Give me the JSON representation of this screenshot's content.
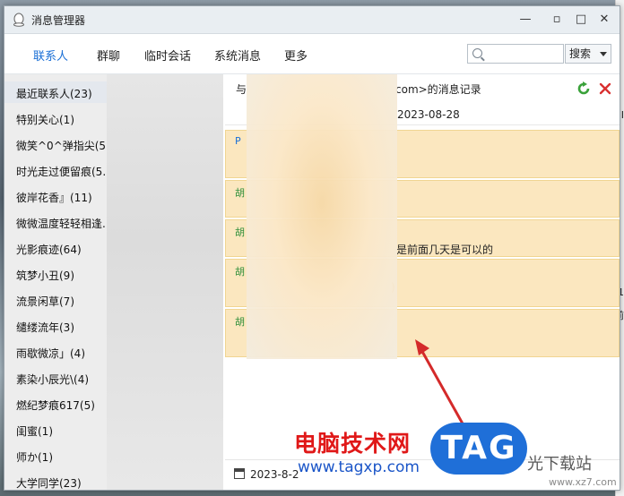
{
  "window": {
    "title": "消息管理器"
  },
  "tabs": [
    "联系人",
    "群聊",
    "临时会话",
    "系统消息",
    "更多"
  ],
  "search": {
    "placeholder": "",
    "button_label": "搜索"
  },
  "sidebar": {
    "items": [
      "最近联系人(23)",
      "特别关心(1)",
      "微笑^0^弹指尖(5...",
      "时光走过便留痕(5...",
      "彼岸花香』(11)",
      "微微温度轻轻相逢...",
      "光影痕迹(64)",
      "筑梦小丑(9)",
      "流景闲草(7)",
      "缱缕流年(3)",
      "雨歇微凉」(4)",
      "素染小辰光\\(4)",
      "燃纪梦痕617(5)",
      "闺蜜(1)",
      "师か(1)",
      "大学同学(23)"
    ]
  },
  "content": {
    "header_left": "与",
    "header_title": "com>的消息记录",
    "date_label": "2023-08-28",
    "messages": [
      {
        "sender": "P",
        "text": ""
      },
      {
        "sender": "胡",
        "text": ""
      },
      {
        "sender": "胡",
        "text": "是前面几天是可以的"
      },
      {
        "sender": "胡",
        "text": ")"
      },
      {
        "sender": "胡",
        "text": ""
      }
    ],
    "bottom_date": "2023-8-2"
  },
  "watermark": {
    "site_cn": "电脑技术网",
    "site_url": "www.tagxp.com",
    "tag": "TAG",
    "right_cn": "光下载站",
    "right_url": "www.xz7.com"
  },
  "desktop": {
    "right_text": [
      "I",
      "1",
      "前"
    ]
  },
  "colors": {
    "accent": "#1a6fd6",
    "message_bg": "#fbe7bf",
    "arrow": "#d42a2a"
  }
}
